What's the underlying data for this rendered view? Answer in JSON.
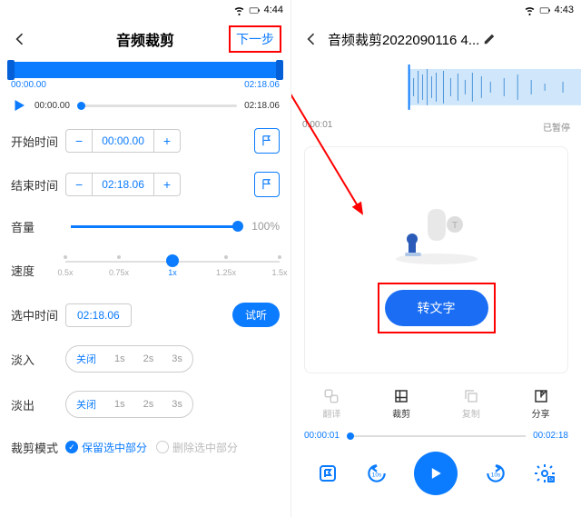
{
  "left": {
    "status_time": "4:44",
    "title": "音频裁剪",
    "next": "下一步",
    "range_start": "00:00.00",
    "range_end": "02:18.06",
    "play_start": "00:00.00",
    "play_end": "02:18.06",
    "start_label": "开始时间",
    "start_value": "00:00.00",
    "end_label": "结束时间",
    "end_value": "02:18.06",
    "volume_label": "音量",
    "volume_value": "100%",
    "speed_label": "速度",
    "speeds": [
      "0.5x",
      "0.75x",
      "1x",
      "1.25x",
      "1.5x"
    ],
    "speed_selected": "1x",
    "selected_label": "选中时间",
    "selected_value": "02:18.06",
    "try_label": "试听",
    "fadein_label": "淡入",
    "fadeout_label": "淡出",
    "fade_options": [
      "关闭",
      "1s",
      "2s",
      "3s"
    ],
    "fade_selected": "关闭",
    "mode_label": "裁剪模式",
    "mode_keep": "保留选中部分",
    "mode_del": "删除选中部分"
  },
  "right": {
    "status_time": "4:43",
    "title": "音频裁剪2022090116 4...",
    "pos": "0:00:01",
    "state": "已暂停",
    "convert": "转文字",
    "tabs": {
      "translate": "翻译",
      "trim": "裁剪",
      "copy": "复制",
      "share": "分享"
    },
    "bb_start": "00:00:01",
    "bb_end": "00:02:18"
  }
}
